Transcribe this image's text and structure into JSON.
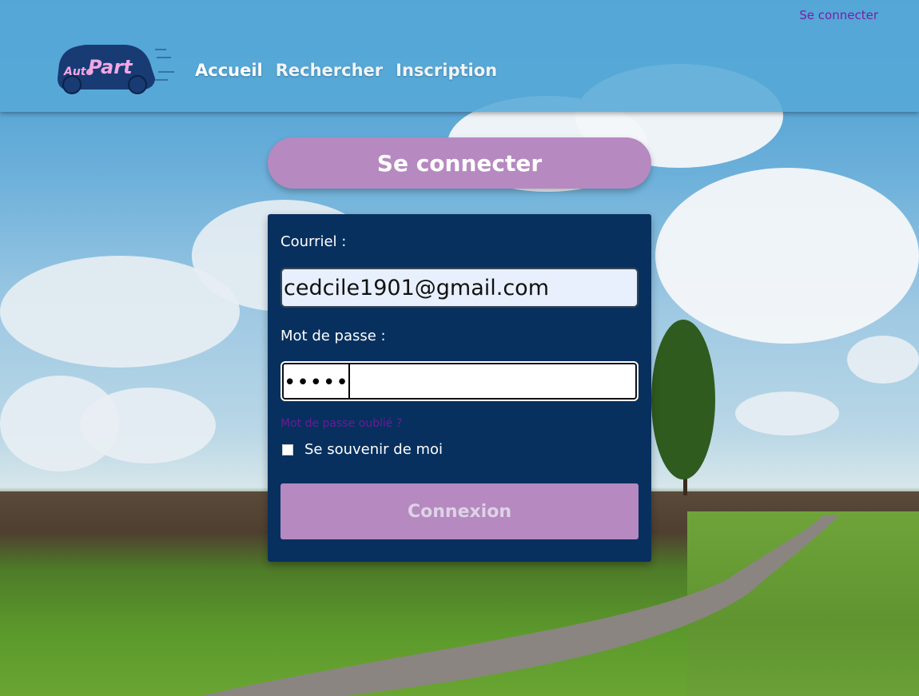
{
  "header": {
    "top_login_link": "Se connecter",
    "logo_text_1": "Auto",
    "logo_text_2": "Part",
    "nav": [
      "Accueil",
      "Rechercher",
      "Inscription"
    ]
  },
  "login": {
    "title": "Se connecter",
    "email_label": "Courriel :",
    "email_value": "cedcile1901@gmail.com",
    "password_label": "Mot de passe :",
    "password_value": "•••••",
    "forgot_link": "Mot de passe oublié ?",
    "remember_label": "Se souvenir de moi",
    "submit_label": "Connexion"
  },
  "colors": {
    "header_bg": "#56a8d7",
    "panel_bg": "#07305e",
    "accent_purple": "#b689c0",
    "link_purple": "#7b1fa2"
  }
}
